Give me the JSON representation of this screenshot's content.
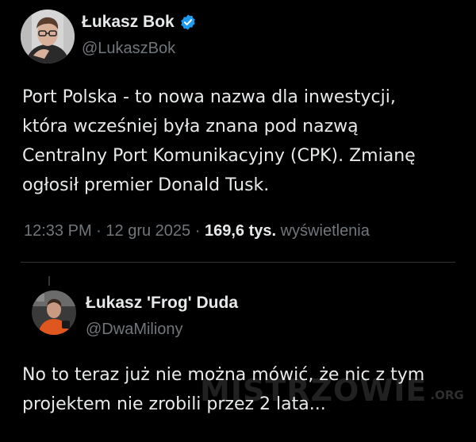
{
  "tweet": {
    "author": {
      "name": "Łukasz Bok",
      "handle": "@LukaszBok",
      "avatar_icon": "profile-photo-man-glasses",
      "verified_color": "#1d9bf0"
    },
    "text": "Port Polska - to nowa nazwa dla inwestycji,\nktóra wcześniej była znana pod nazwą\nCentralny Port Komunikacyjny (CPK). Zmianę\nogłosił premier Donald Tusk.",
    "time": "12:33 PM",
    "separator": "·",
    "date": "12 gru 2025",
    "views_count": "169,6 tys.",
    "views_label": "wyświetlenia"
  },
  "reply": {
    "author": {
      "name": "Łukasz 'Frog' Duda",
      "handle": "@DwaMiliony",
      "avatar_icon": "profile-photo-man-orange-shirt"
    },
    "text": "No to teraz już nie można mówić, że nic z tym\nprojektem nie zrobili przez 2 lata..."
  },
  "watermark": {
    "main": "MISTRZOWIE",
    "sub": ".ORG"
  },
  "colors": {
    "background": "#000000",
    "text_primary": "#e7e9ea",
    "text_secondary": "#71767b",
    "divider": "#2f3336",
    "verified": "#1d9bf0"
  }
}
